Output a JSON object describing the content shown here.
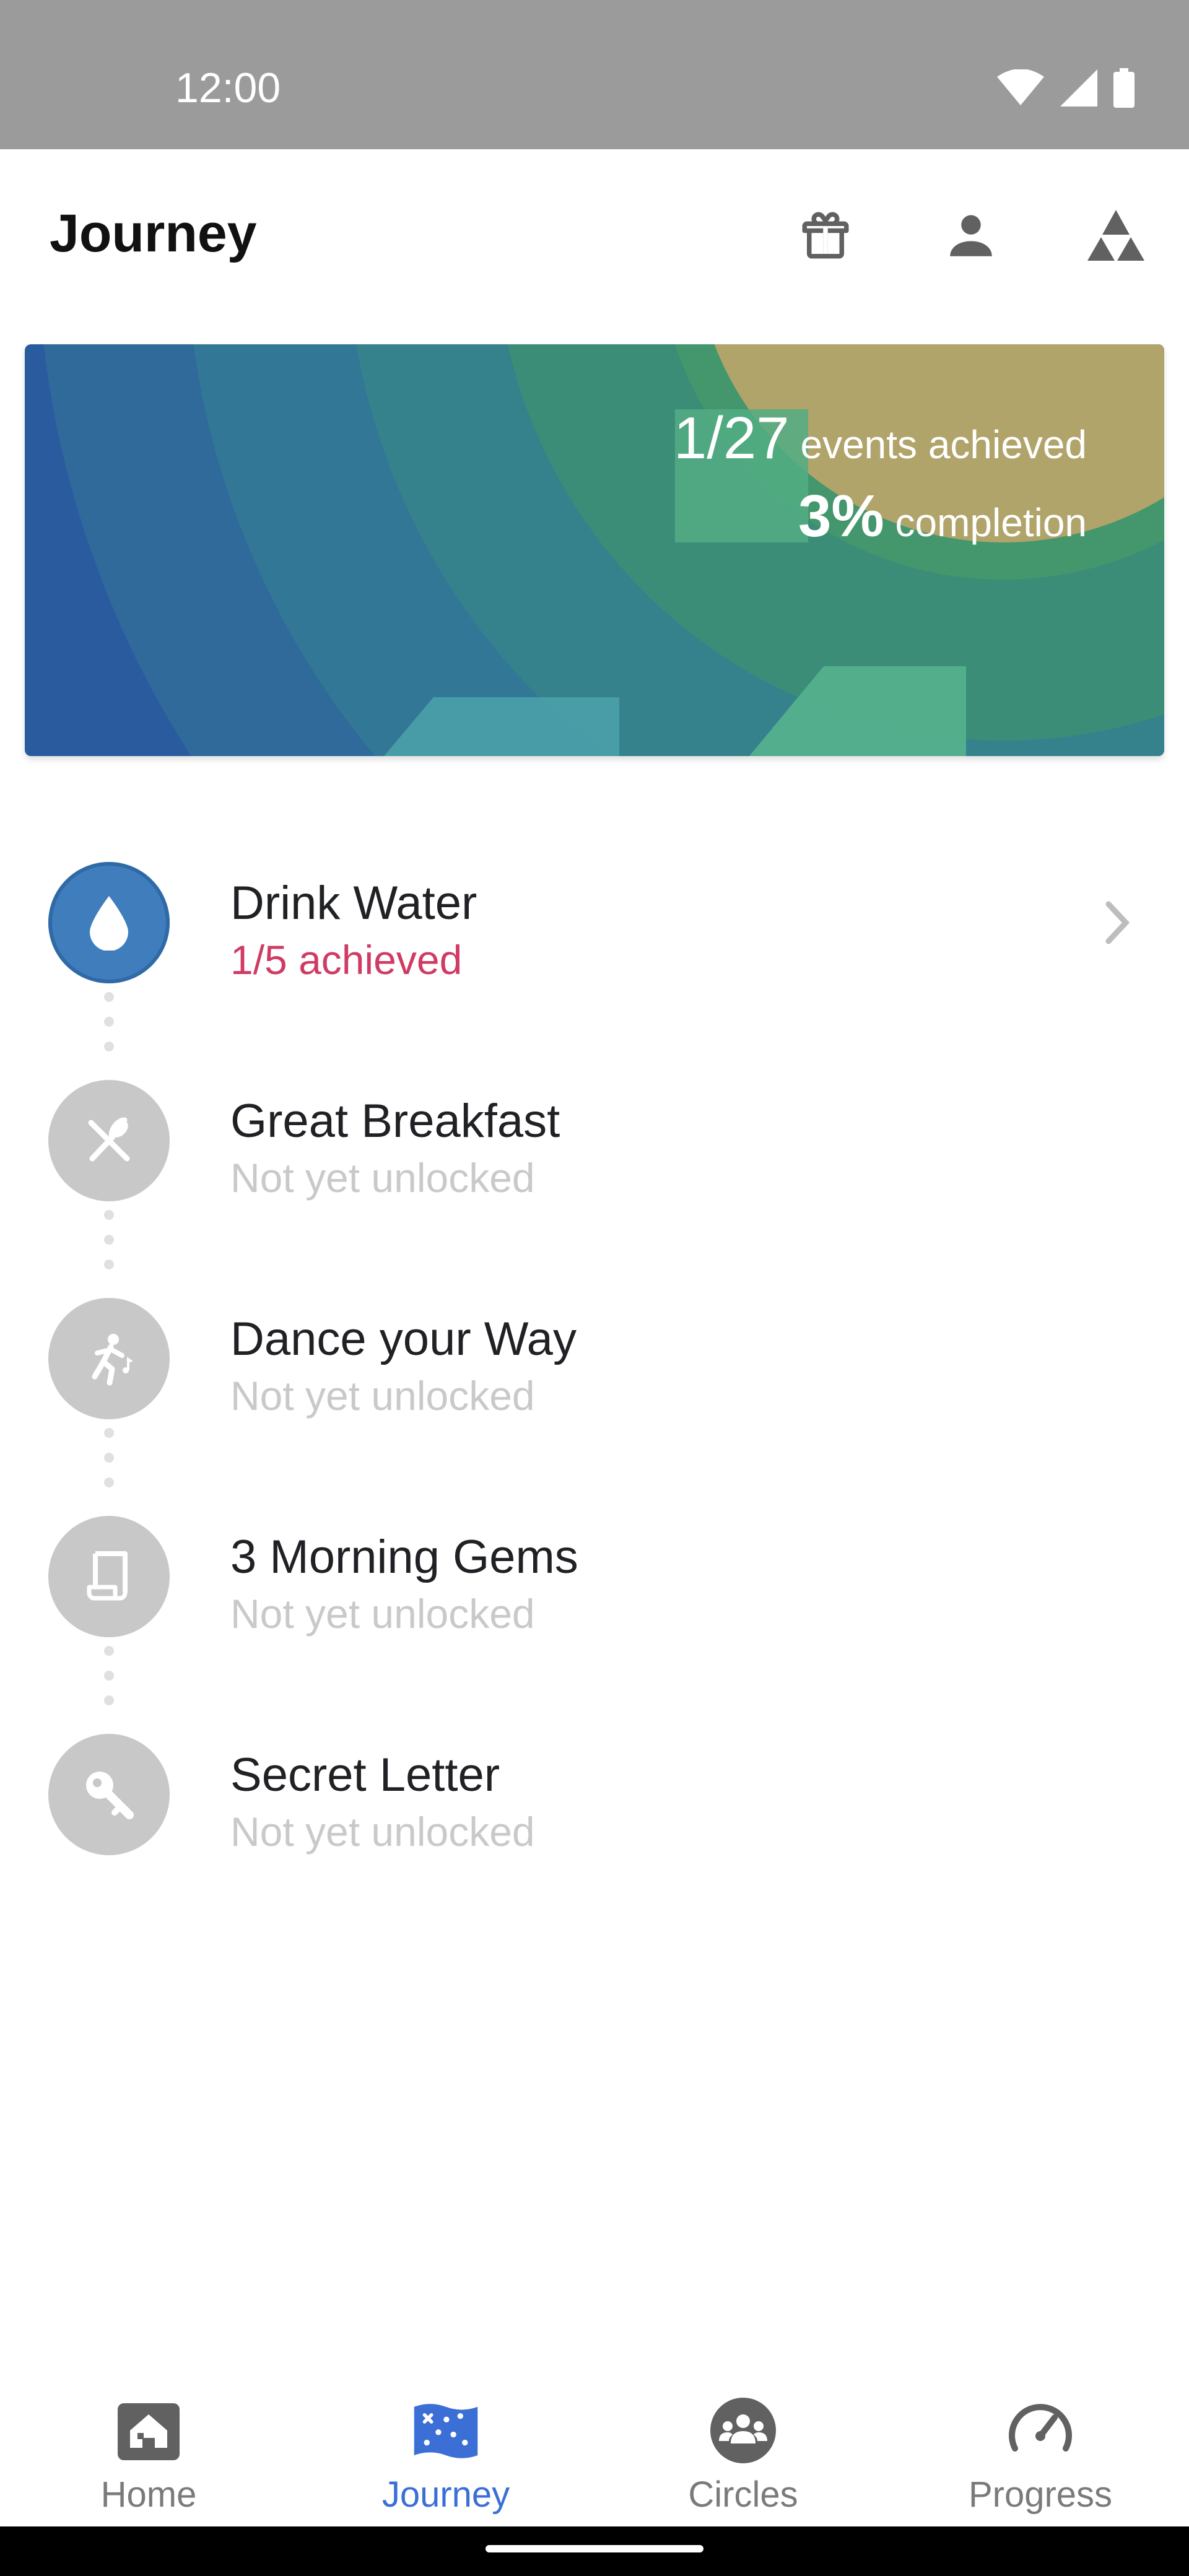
{
  "status_bar": {
    "time": "12:00",
    "icons": [
      "wifi-icon",
      "signal-icon",
      "battery-icon"
    ]
  },
  "app_bar": {
    "title": "Journey",
    "actions": [
      "gift-icon",
      "account-icon",
      "triangles-icon"
    ]
  },
  "banner": {
    "events_count": "1/27",
    "events_label": "events achieved",
    "completion_value": "3%",
    "completion_label": "completion",
    "progress_fraction": 0.03
  },
  "journey": {
    "items": [
      {
        "title": "Drink Water",
        "subtitle": "1/5 achieved",
        "icon": "water-drop-icon",
        "state": "active"
      },
      {
        "title": "Great Breakfast",
        "subtitle": "Not yet unlocked",
        "icon": "utensils-icon",
        "state": "locked"
      },
      {
        "title": "Dance your Way",
        "subtitle": "Not yet unlocked",
        "icon": "dance-icon",
        "state": "locked"
      },
      {
        "title": "3 Morning Gems",
        "subtitle": "Not yet unlocked",
        "icon": "scroll-icon",
        "state": "locked"
      },
      {
        "title": "Secret Letter",
        "subtitle": "Not yet unlocked",
        "icon": "key-icon",
        "state": "locked"
      }
    ]
  },
  "bottom_nav": {
    "items": [
      {
        "label": "Home",
        "icon": "home-icon",
        "active": false
      },
      {
        "label": "Journey",
        "icon": "journey-map-icon",
        "active": true
      },
      {
        "label": "Circles",
        "icon": "circles-icon",
        "active": false
      },
      {
        "label": "Progress",
        "icon": "gauge-icon",
        "active": false
      }
    ]
  },
  "colors": {
    "accent": "#3b6fd6",
    "achieved_text": "#d03b63",
    "active_circle": "#3f7dbd",
    "locked_circle": "#c8c8c8",
    "status_bar": "#9b9b9b"
  }
}
